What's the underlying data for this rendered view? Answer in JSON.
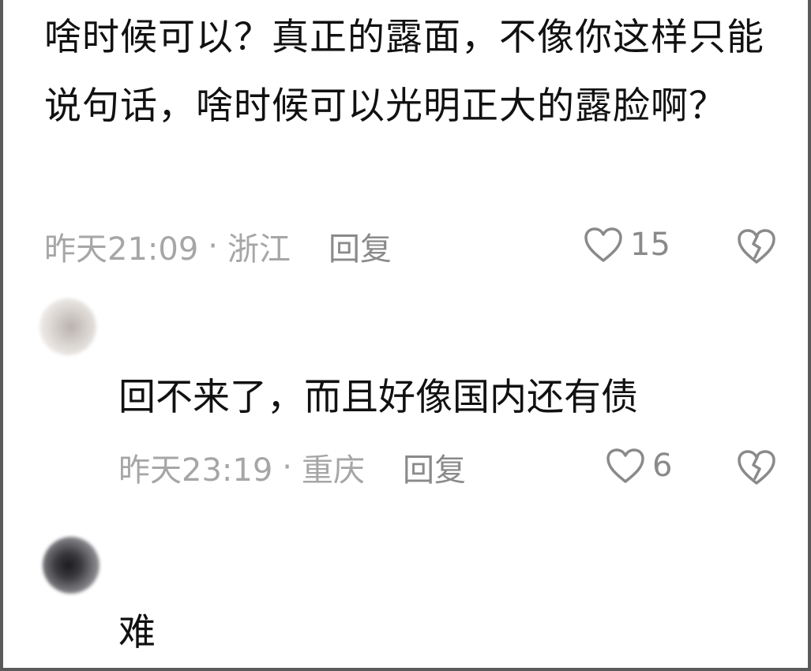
{
  "comments": [
    {
      "text": "啥时候可以？真正的露面，不像你这样只能说句话，啥时候可以光明正大的露脸啊？",
      "time": "昨天21:09",
      "separator": "·",
      "location": "浙江",
      "reply_label": "回复",
      "likes": "15"
    },
    {
      "text": "回不来了，而且好像国内还有债",
      "time": "昨天23:19",
      "separator": "·",
      "location": "重庆",
      "reply_label": "回复",
      "likes": "6"
    },
    {
      "text": "难"
    }
  ],
  "icons": {
    "like": "heart-outline-icon",
    "dislike": "broken-heart-icon"
  },
  "colors": {
    "text": "#111111",
    "meta": "#a6a6a6",
    "action": "#8a8a8a",
    "border": "#5a5a5a"
  }
}
